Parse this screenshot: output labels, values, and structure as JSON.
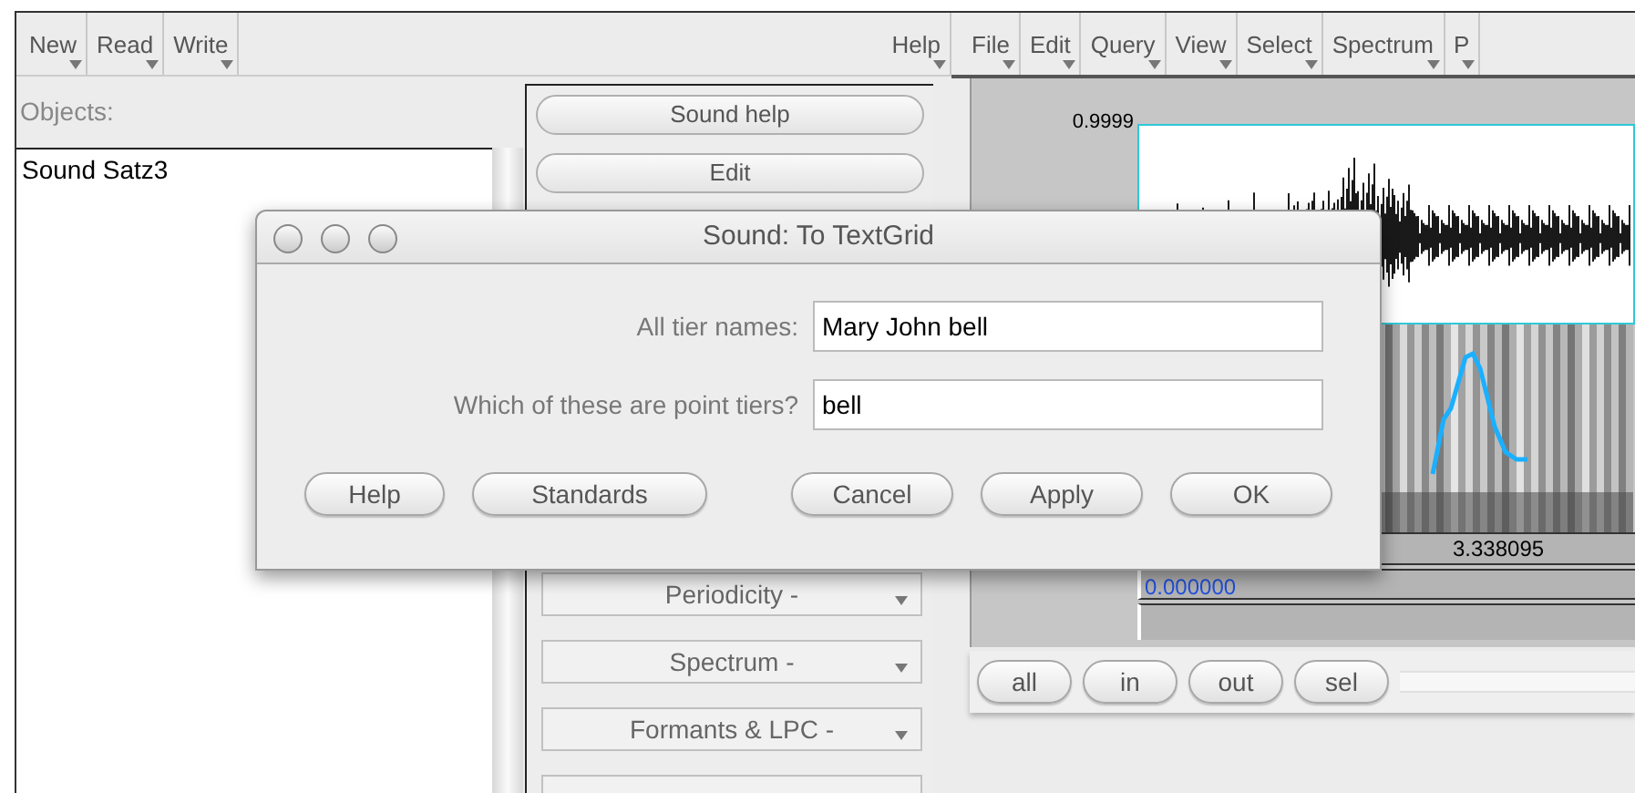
{
  "objects_window": {
    "menus": [
      {
        "label": "New"
      },
      {
        "label": "Read"
      },
      {
        "label": "Write"
      }
    ],
    "help_menu": {
      "label": "Help"
    },
    "objects_label": "Objects:",
    "objects": [
      {
        "name": "Sound Satz3"
      }
    ],
    "actions": [
      {
        "kind": "push",
        "label": "Sound help"
      },
      {
        "kind": "push",
        "label": "Edit"
      },
      {
        "kind": "menu",
        "label": "Periodicity -"
      },
      {
        "kind": "menu",
        "label": "Spectrum -"
      },
      {
        "kind": "menu",
        "label": "Formants & LPC -"
      },
      {
        "kind": "menu"
      }
    ]
  },
  "editor_window": {
    "menus": [
      {
        "label": "File"
      },
      {
        "label": "Edit"
      },
      {
        "label": "Query"
      },
      {
        "label": "View"
      },
      {
        "label": "Select"
      },
      {
        "label": "Spectrum"
      },
      {
        "label": "P"
      }
    ],
    "amplitude_label": "0.9999",
    "cursor_time": "3.338095",
    "window_start": "0.000000",
    "zoom_buttons": [
      {
        "label": "all"
      },
      {
        "label": "in"
      },
      {
        "label": "out"
      },
      {
        "label": "sel"
      }
    ]
  },
  "dialog": {
    "title": "Sound: To TextGrid",
    "fields": [
      {
        "label": "All tier names:",
        "value": "Mary John bell"
      },
      {
        "label": "Which of these are point tiers?",
        "value": "bell"
      }
    ],
    "left_buttons": [
      {
        "label": "Help"
      },
      {
        "label": "Standards"
      }
    ],
    "right_buttons": [
      {
        "label": "Cancel"
      },
      {
        "label": "Apply"
      },
      {
        "label": "OK"
      }
    ]
  }
}
